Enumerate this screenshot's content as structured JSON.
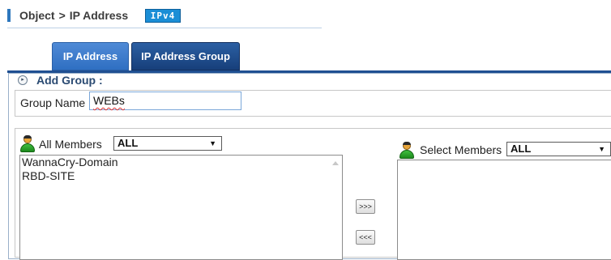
{
  "breadcrumb": {
    "section": "Object",
    "separator": ">",
    "page": "IP Address",
    "badge": "IPv4"
  },
  "tabs": [
    {
      "label": "IP Address",
      "active": true
    },
    {
      "label": "IP Address Group",
      "active": false
    }
  ],
  "form": {
    "section_title": "Add Group :",
    "group_name_label": "Group Name",
    "group_name_value": "WEBs"
  },
  "all_members": {
    "label": "All Members",
    "filter_value": "ALL",
    "items": [
      "WannaCry-Domain",
      "RBD-SITE"
    ]
  },
  "transfer": {
    "add_label": ">>>",
    "remove_label": "<<<"
  },
  "select_members": {
    "label": "Select Members",
    "filter_value": "ALL",
    "items": []
  },
  "colors": {
    "tab_active": "#3d7ccb",
    "tab_inactive": "#1f4f92",
    "badge": "#1b8ed6",
    "breadcrumb_bar": "#2d77bd"
  },
  "icons": [
    "user-icon",
    "expand-circle-icon",
    "chevron-down-icon",
    "scroll-up-icon"
  ]
}
